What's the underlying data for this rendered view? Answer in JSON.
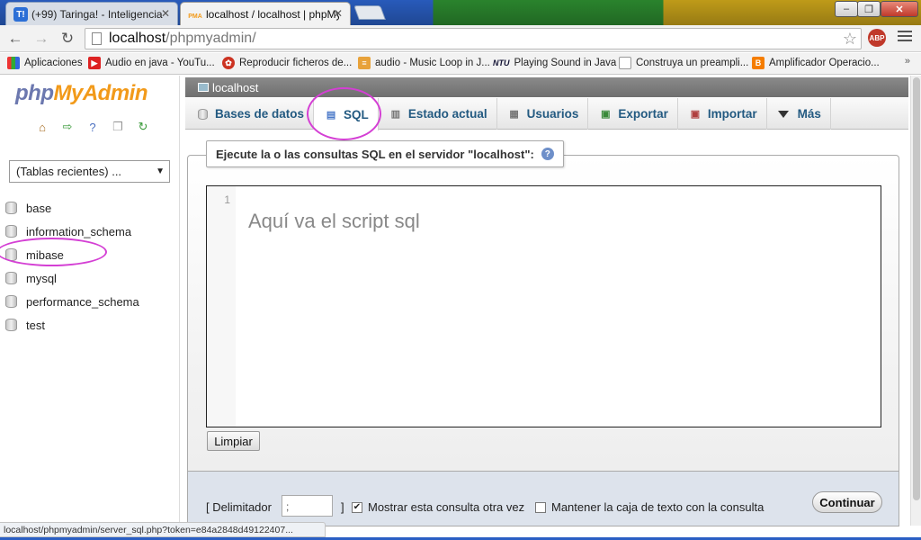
{
  "browser": {
    "tabs": [
      {
        "favicon": "T!",
        "title": "(+99) Taringa! - Inteligencia"
      },
      {
        "favicon": "PMA",
        "title": "localhost / localhost | phpMy"
      }
    ],
    "address": {
      "host": "localhost",
      "path": "/phpmyadmin/"
    },
    "abp_label": "ABP",
    "bookmarks": [
      "Aplicaciones",
      "Audio en java - YouTu...",
      "Reproducir ficheros de...",
      "audio - Music Loop in J...",
      "Playing Sound in Java",
      "Construya un preampli...",
      "Amplificador Operacio..."
    ],
    "bookmark_ntu_label": "NTU",
    "more": "»"
  },
  "sidebar": {
    "logo": {
      "php": "php",
      "my": "My",
      "admin": "Admin"
    },
    "recent_select": "(Tablas recientes) ...",
    "databases": [
      "base",
      "information_schema",
      "mibase",
      "mysql",
      "performance_schema",
      "test"
    ]
  },
  "main": {
    "server": "localhost",
    "tabs": [
      {
        "label": "Bases de datos",
        "icon": "database-icon"
      },
      {
        "label": "SQL",
        "icon": "sql-icon"
      },
      {
        "label": "Estado actual",
        "icon": "status-icon"
      },
      {
        "label": "Usuarios",
        "icon": "users-icon"
      },
      {
        "label": "Exportar",
        "icon": "export-icon"
      },
      {
        "label": "Importar",
        "icon": "import-icon"
      },
      {
        "label": "Más",
        "icon": "dropdown-icon"
      }
    ],
    "active_tab": "SQL",
    "legend": "Ejecute la o las consultas SQL en el servidor \"localhost\":",
    "editor": {
      "line_number": "1",
      "content": "Aquí va el script sql"
    },
    "clear_button": "Limpiar",
    "delimiter_label": "[ Delimitador",
    "delimiter_value": ";",
    "delimiter_close": "]",
    "show_query_label": "Mostrar esta consulta otra vez",
    "show_query_checked": true,
    "keep_box_label": "Mantener la caja de texto con la consulta",
    "keep_box_checked": false,
    "continue_button": "Continuar"
  },
  "statusbar": "localhost/phpmyadmin/server_sql.php?token=e84a2848d49122407...",
  "colors": {
    "annotation": "#d43fd4",
    "tab_text": "#235a81",
    "logo_orange": "#f29a1a",
    "logo_blue": "#6c78af"
  }
}
